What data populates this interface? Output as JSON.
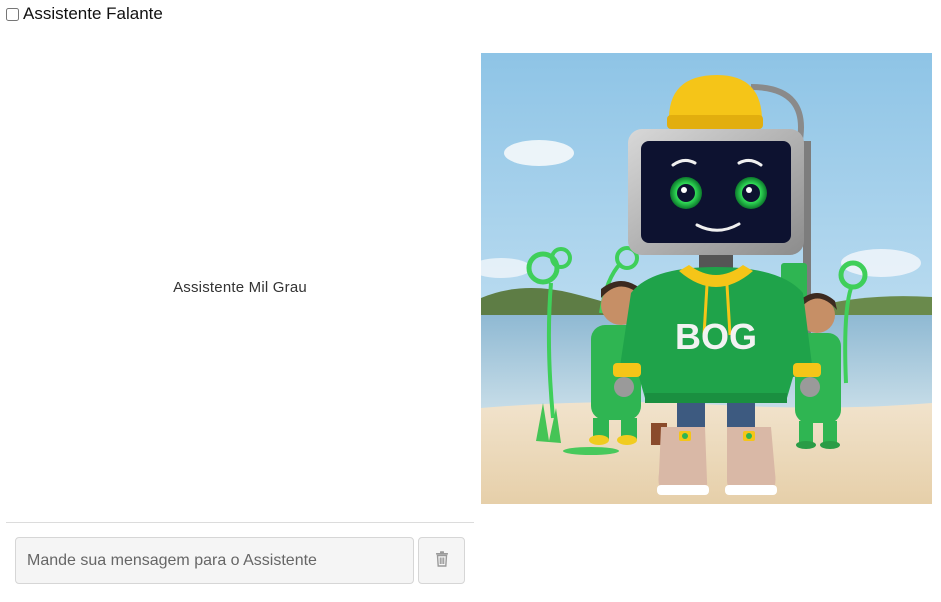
{
  "header": {
    "speaking_assistant_label": "Assistente Falante",
    "speaking_assistant_checked": false
  },
  "chat": {
    "assistant_name": "Assistente Mil Grau"
  },
  "composer": {
    "message_placeholder": "Mande sua mensagem para o Assistente",
    "clear_icon": "trash-icon"
  },
  "avatar": {
    "hoodie_text": "BOG",
    "icon": "robot-mascot-image"
  },
  "colors": {
    "hoodie_green": "#1fa34a",
    "cap_yellow": "#f5c518",
    "screen_dark": "#0d1230",
    "eye_green": "#34e35a",
    "sky_blue": "#aed6ee",
    "sand": "#efdcc0"
  }
}
